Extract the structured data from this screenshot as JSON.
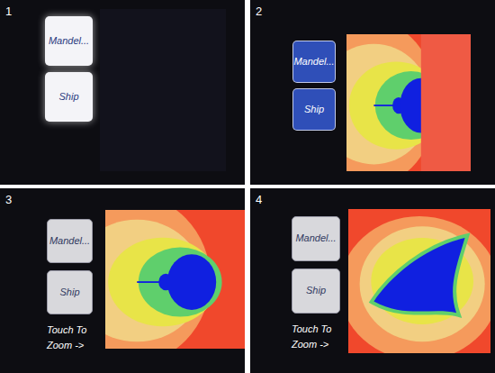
{
  "panels": [
    {
      "number": "1",
      "kind": "off",
      "buttons": [
        {
          "label": "Mandel..."
        },
        {
          "label": "Ship"
        }
      ]
    },
    {
      "number": "2",
      "kind": "rendering",
      "level": 0.6,
      "buttons": [
        {
          "label": "Mandel..."
        },
        {
          "label": "Ship"
        }
      ]
    },
    {
      "number": "3",
      "kind": "mandelbrot",
      "buttons": [
        {
          "label": "Mandel..."
        },
        {
          "label": "Ship"
        }
      ],
      "hint": "Touch To Zoom ->"
    },
    {
      "number": "4",
      "kind": "ship",
      "buttons": [
        {
          "label": "Mandel..."
        },
        {
          "label": "Ship"
        }
      ],
      "hint": "Touch To Zoom ->"
    }
  ]
}
